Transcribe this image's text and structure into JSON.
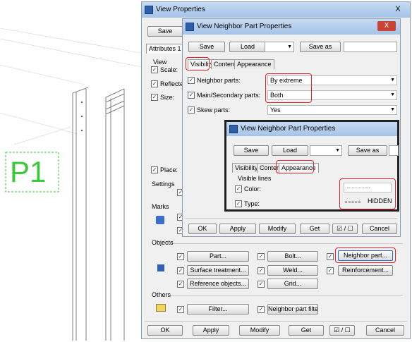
{
  "cad": {
    "label": "P1"
  },
  "view_properties": {
    "title": "View Properties",
    "save_label": "Save",
    "tab_attributes": "Attributes 1",
    "view_label": "View",
    "scale_label": "Scale:",
    "reflected_label": "Reflected",
    "size_label": "Size:",
    "place_label": "Place:",
    "settings_label": "Settings",
    "marks_label": "Marks",
    "objects_label": "Objects",
    "others_label": "Others",
    "btn_part": "Part...",
    "btn_bolt": "Bolt...",
    "btn_neighbor_part": "Neighbor part...",
    "btn_surface": "Surface treatment...",
    "btn_weld": "Weld...",
    "btn_reinforcement": "Reinforcement...",
    "btn_reference": "Reference objects...",
    "btn_grid": "Grid...",
    "btn_filter": "Filter...",
    "btn_neighbor_filter": "Neighbor part filter...",
    "ok": "OK",
    "apply": "Apply",
    "modify": "Modify",
    "get": "Get",
    "toggle": "☑ / ☐",
    "cancel": "Cancel"
  },
  "neighbor_dialog": {
    "title": "View Neighbor Part Properties",
    "save": "Save",
    "load": "Load",
    "save_as": "Save as",
    "tabs": [
      "Visibility",
      "Content",
      "Appearance"
    ],
    "neighbor_parts_label": "Neighbor parts:",
    "neighbor_parts_value": "By extreme",
    "main_secondary_label": "Main/Secondary parts:",
    "main_secondary_value": "Both",
    "skew_label": "Skew parts:",
    "skew_value": "Yes",
    "ok": "OK",
    "apply": "Apply",
    "modify": "Modify",
    "get": "Get",
    "toggle": "☑ / ☐",
    "cancel": "Cancel"
  },
  "appearance_dialog": {
    "title": "View Neighbor Part Properties",
    "save": "Save",
    "load": "Load",
    "save_as": "Save as",
    "tabs": [
      "Visibility",
      "Content",
      "Appearance"
    ],
    "visible_lines_label": "Visible lines",
    "color_label": "Color:",
    "type_label": "Type:",
    "type_value": "HIDDEN"
  },
  "close_glyph": "X",
  "colors": {
    "highlight": "#e0202a",
    "cad_green": "#3cc83c",
    "title_gradient_top": "#c7dbf3"
  }
}
